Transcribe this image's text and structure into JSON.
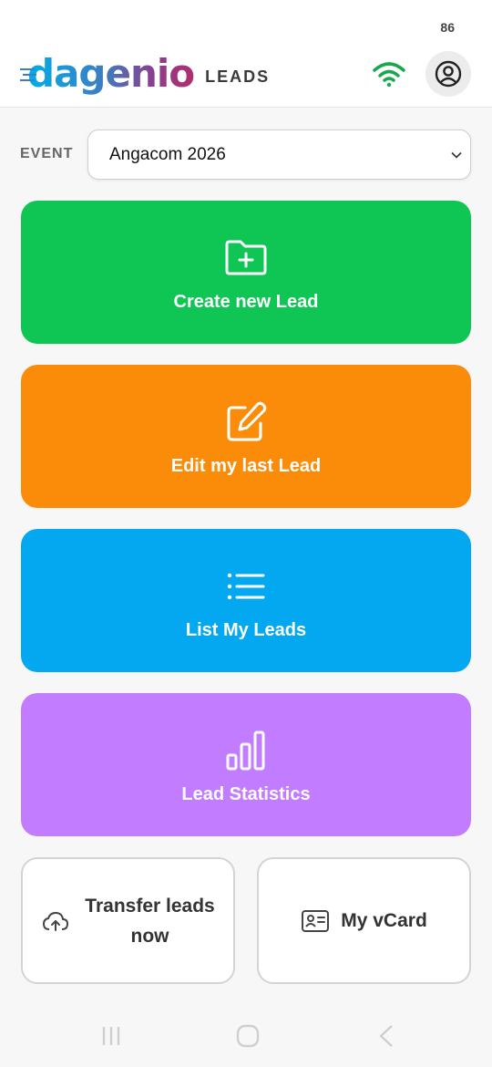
{
  "status_bar": {
    "battery": "86"
  },
  "header": {
    "logo_text": "dagenio",
    "app_label": "LEADS",
    "icons": {
      "wifi": "wifi-icon",
      "account": "user-circle-icon"
    }
  },
  "event": {
    "label": "EVENT",
    "selected": "Angacom 2026"
  },
  "actions": [
    {
      "label": "Create new Lead",
      "icon": "folder-plus-icon",
      "color": "#0fc655"
    },
    {
      "label": "Edit my last Lead",
      "icon": "edit-icon",
      "color": "#fb8c0a"
    },
    {
      "label": "List My Leads",
      "icon": "list-icon",
      "color": "#03a8f0"
    },
    {
      "label": "Lead Statistics",
      "icon": "bar-chart-icon",
      "color": "#c17cff"
    }
  ],
  "secondary": [
    {
      "label": "Transfer leads now",
      "icon": "cloud-upload-icon"
    },
    {
      "label": "My vCard",
      "icon": "id-card-icon"
    }
  ],
  "colors": {
    "wifi": "#1aa84f",
    "header_bg": "#ffffff",
    "page_bg": "#f7f7f7"
  }
}
